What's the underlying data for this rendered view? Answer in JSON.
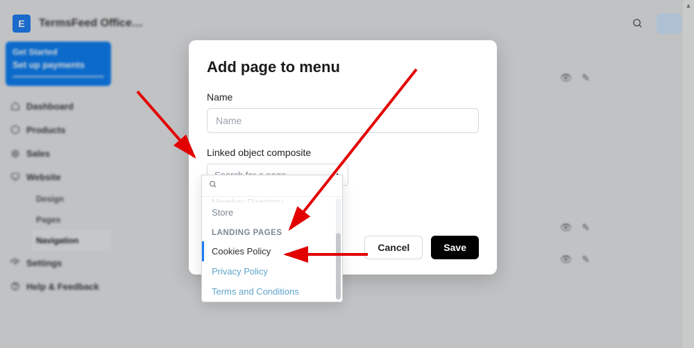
{
  "brand": {
    "badge_letter": "E",
    "name": "TermsFeed Office…"
  },
  "topbar": {
    "search_icon": "search",
    "avatar": ""
  },
  "sidebar": {
    "onboard": {
      "title": "Get Started",
      "sub": "Set up payments"
    },
    "items": [
      {
        "label": "Dashboard"
      },
      {
        "label": "Products"
      },
      {
        "label": "Sales"
      },
      {
        "label": "Website"
      },
      {
        "label": "Settings"
      },
      {
        "label": "Help & Feedback"
      }
    ],
    "subnav": [
      {
        "label": "Design"
      },
      {
        "label": "Pages"
      },
      {
        "label": "Navigation",
        "active": true
      }
    ]
  },
  "modal": {
    "title": "Add page to menu",
    "name_label": "Name",
    "name_placeholder": "Name",
    "linked_label": "Linked object composite",
    "combo_placeholder": "Search for a page",
    "cancel": "Cancel",
    "save": "Save"
  },
  "dropdown": {
    "partial_top": "Member Directory",
    "store": "Store",
    "section": "LANDING PAGES",
    "items": [
      {
        "label": "Cookies Policy",
        "selected": true
      },
      {
        "label": "Privacy Policy"
      },
      {
        "label": "Terms and Conditions"
      }
    ]
  }
}
